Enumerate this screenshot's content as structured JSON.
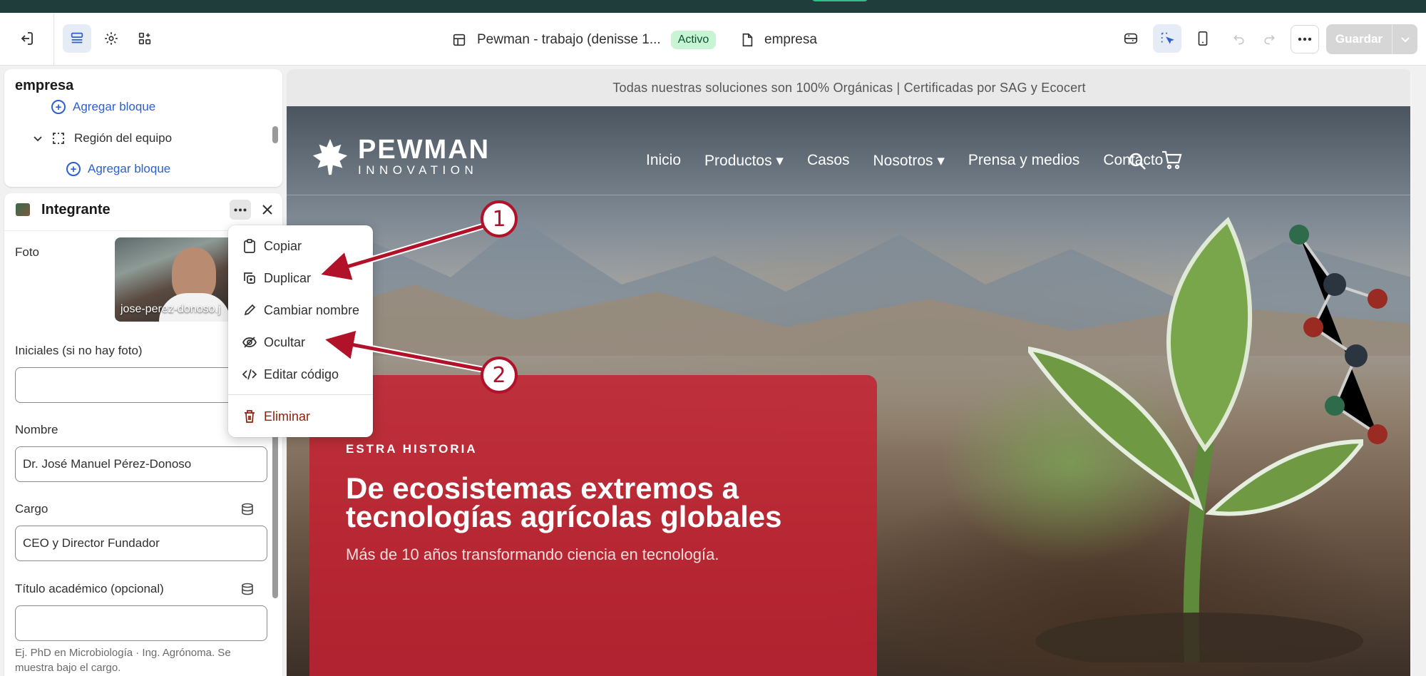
{
  "toolbar": {
    "exit_icon": "exit-icon",
    "sections_icon": "sections-icon",
    "settings_icon": "gear-icon",
    "apps_icon": "apps-icon",
    "theme_name": "Pewman - trabajo (denisse 1...",
    "theme_status": "Activo",
    "template_name": "empresa",
    "save_label": "Guardar"
  },
  "sections_panel": {
    "title": "empresa",
    "add_block_label": "Agregar bloque",
    "region_label": "Región del equipo",
    "add_block_label_2": "Agregar bloque"
  },
  "block_panel": {
    "title": "Integrante",
    "photo_label": "Foto",
    "photo_filename": "jose-perez-donoso.j",
    "initials_label": "Iniciales (si no hay foto)",
    "initials_value": "",
    "name_label": "Nombre",
    "name_value": "Dr. José Manuel Pérez-Donoso",
    "role_label": "Cargo",
    "role_value": "CEO y Director Fundador",
    "degree_label": "Título académico (opcional)",
    "degree_value": "",
    "degree_hint": "Ej. PhD en Microbiología · Ing. Agrónoma. Se muestra bajo el cargo."
  },
  "context_menu": {
    "items": [
      {
        "label": "Copiar",
        "icon": "clipboard-icon"
      },
      {
        "label": "Duplicar",
        "icon": "duplicate-icon"
      },
      {
        "label": "Cambiar nombre",
        "icon": "pencil-icon"
      },
      {
        "label": "Ocultar",
        "icon": "eye-off-icon"
      },
      {
        "label": "Editar código",
        "icon": "code-icon"
      },
      {
        "label": "Eliminar",
        "icon": "trash-icon"
      }
    ]
  },
  "preview": {
    "announcement": "Todas nuestras soluciones son 100% Orgánicas | Certificadas por SAG y Ecocert",
    "logo_main": "PEWMAN",
    "logo_sub": "INNOVATION",
    "nav": [
      "Inicio",
      "Productos ▾",
      "Casos",
      "Nosotros ▾",
      "Prensa y medios",
      "Contacto"
    ],
    "eyebrow": "ESTRA HISTORIA",
    "headline": "De ecosistemas extremos a tecnologías agrícolas globales",
    "subheadline": "Más de 10 años transformando ciencia en tecnología."
  },
  "annotations": {
    "callout_1": "1",
    "callout_2": "2",
    "color": "#b11229"
  }
}
